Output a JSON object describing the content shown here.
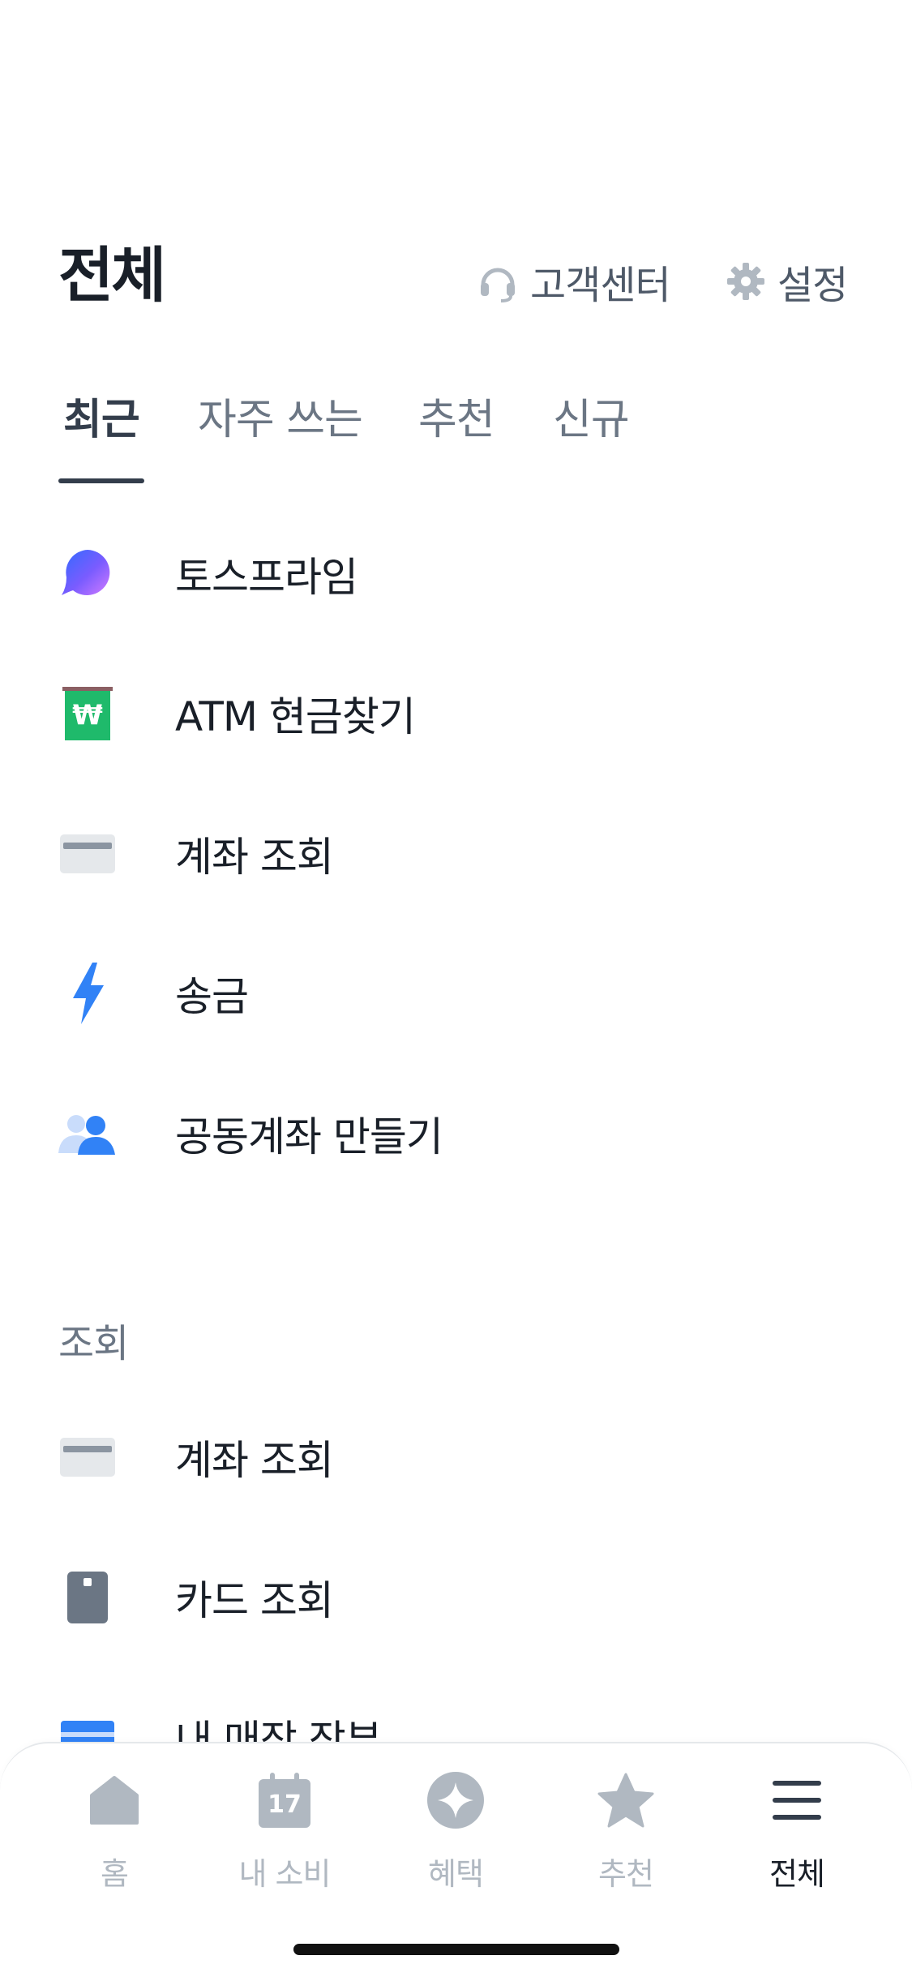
{
  "header": {
    "title": "전체",
    "support_label": "고객센터",
    "settings_label": "설정"
  },
  "tabs": [
    {
      "label": "최근",
      "active": true
    },
    {
      "label": "자주 쓰는",
      "active": false
    },
    {
      "label": "추천",
      "active": false
    },
    {
      "label": "신규",
      "active": false
    }
  ],
  "recent": [
    {
      "label": "토스프라임",
      "icon": "toss-prime-icon"
    },
    {
      "label": "ATM 현금찾기",
      "icon": "atm-won-icon"
    },
    {
      "label": "계좌 조회",
      "icon": "account-card-icon"
    },
    {
      "label": "송금",
      "icon": "lightning-icon"
    },
    {
      "label": "공동계좌 만들기",
      "icon": "people-icon"
    }
  ],
  "section_lookup": {
    "title": "조회",
    "items": [
      {
        "label": "계좌 조회",
        "icon": "account-card-icon"
      },
      {
        "label": "카드 조회",
        "icon": "card-icon"
      },
      {
        "label": "내 매장 장부",
        "icon": "ledger-icon"
      }
    ]
  },
  "tabbar": [
    {
      "label": "홈",
      "icon": "home-icon",
      "active": false
    },
    {
      "label": "내 소비",
      "icon": "calendar-icon",
      "calendar_day": "17",
      "active": false
    },
    {
      "label": "혜택",
      "icon": "sparkle-icon",
      "active": false
    },
    {
      "label": "추천",
      "icon": "star-icon",
      "active": false
    },
    {
      "label": "전체",
      "icon": "menu-icon",
      "active": true
    }
  ],
  "colors": {
    "text_primary": "#191f28",
    "text_secondary": "#6b7684",
    "inactive_icon": "#b0b8c1",
    "accent_blue": "#3182f6",
    "atm_green": "#1fba6b"
  }
}
